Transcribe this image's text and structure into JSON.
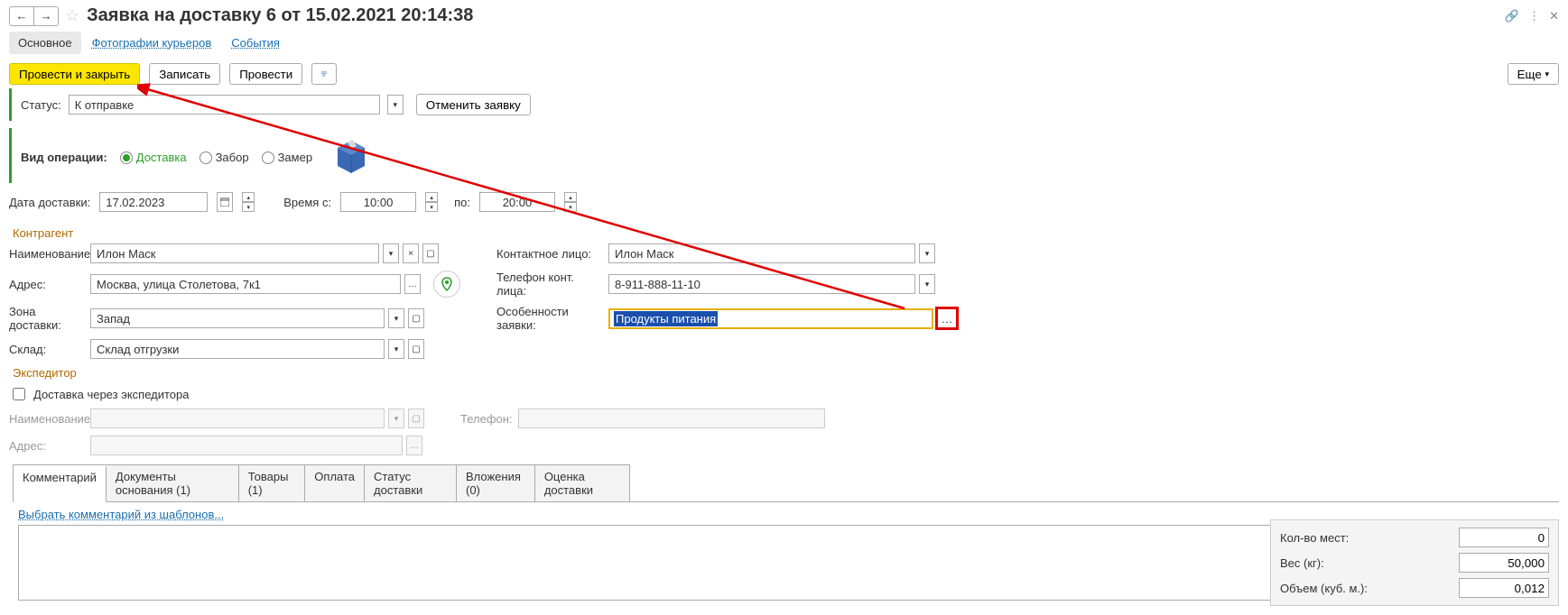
{
  "header": {
    "title": "Заявка на доставку 6 от 15.02.2021 20:14:38"
  },
  "navTabs": {
    "main": "Основное",
    "photos": "Фотографии курьеров",
    "events": "События"
  },
  "actions": {
    "postClose": "Провести и закрыть",
    "save": "Записать",
    "post": "Провести",
    "more": "Еще"
  },
  "status": {
    "label": "Статус:",
    "value": "К отправке",
    "cancel": "Отменить заявку"
  },
  "operation": {
    "label": "Вид операции:",
    "delivery": "Доставка",
    "pickup": "Забор",
    "measure": "Замер"
  },
  "dates": {
    "dateLabel": "Дата доставки:",
    "dateValue": "17.02.2023",
    "fromLabel": "Время с:",
    "fromValue": "10:00",
    "toLabel": "по:",
    "toValue": "20:00"
  },
  "counterparty": {
    "title": "Контрагент",
    "nameLabel": "Наименование:",
    "nameValue": "Илон Маск",
    "addrLabel": "Адрес:",
    "addrValue": "Москва, улица Столетова, 7к1",
    "zoneLabel": "Зона доставки:",
    "zoneValue": "Запад",
    "whLabel": "Склад:",
    "whValue": "Склад отгрузки",
    "contactLabel": "Контактное лицо:",
    "contactValue": "Илон Маск",
    "phoneLabel": "Телефон конт. лица:",
    "phoneValue": "8-911-888-11-10",
    "featuresLabel": "Особенности заявки:",
    "featuresValue": "Продукты питания"
  },
  "forwarder": {
    "title": "Экспедитор",
    "viaLabel": "Доставка через экспедитора",
    "nameLabel": "Наименование:",
    "phoneLabel": "Телефон:",
    "addrLabel": "Адрес:"
  },
  "tabs2": {
    "comment": "Комментарий",
    "docs": "Документы основания (1)",
    "goods": "Товары (1)",
    "payment": "Оплата",
    "delStatus": "Статус доставки",
    "attach": "Вложения (0)",
    "rating": "Оценка доставки"
  },
  "commentLink": "Выбрать комментарий из шаблонов...",
  "summary": {
    "placesLabel": "Кол-во мест:",
    "placesValue": "0",
    "weightLabel": "Вес (кг):",
    "weightValue": "50,000",
    "volumeLabel": "Объем (куб. м.):",
    "volumeValue": "0,012"
  }
}
